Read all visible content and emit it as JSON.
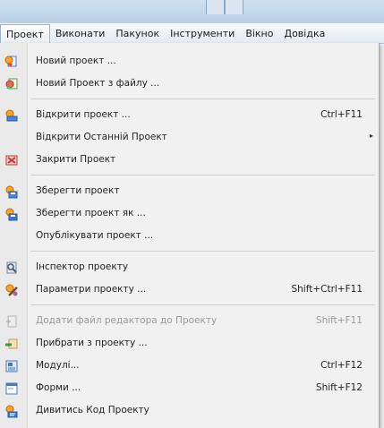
{
  "menubar": {
    "items": [
      {
        "label": "Проект"
      },
      {
        "label": "Виконати"
      },
      {
        "label": "Пакунок"
      },
      {
        "label": "Інструменти"
      },
      {
        "label": "Вікно"
      },
      {
        "label": "Довідка"
      }
    ]
  },
  "menu": {
    "items": [
      {
        "label": "Новий проект ...",
        "shortcut": "",
        "icon": "new-project-icon"
      },
      {
        "label": "Новий Проект з файлу ...",
        "shortcut": "",
        "icon": "new-project-from-file-icon"
      },
      {
        "label": "Відкрити проект ...",
        "shortcut": "Ctrl+F11",
        "icon": "open-project-icon"
      },
      {
        "label": "Відкрити Останній Проект",
        "shortcut": "",
        "arrow": "▸"
      },
      {
        "label": "Закрити Проект",
        "shortcut": "",
        "icon": "close-project-icon"
      },
      {
        "label": "Зберегти проект",
        "shortcut": "",
        "icon": "save-project-icon"
      },
      {
        "label": "Зберегти проект як ...",
        "shortcut": "",
        "icon": "save-project-as-icon"
      },
      {
        "label": "Опублікувати проект ...",
        "shortcut": ""
      },
      {
        "label": "Інспектор проекту",
        "shortcut": "",
        "icon": "project-inspector-icon"
      },
      {
        "label": "Параметри проекту ...",
        "shortcut": "Shift+Ctrl+F11",
        "icon": "project-options-icon"
      },
      {
        "label": "Додати файл редактора до Проекту",
        "shortcut": "Shift+F11",
        "icon": "add-editor-file-icon",
        "disabled": true
      },
      {
        "label": "Прибрати з проекту ...",
        "shortcut": "",
        "icon": "remove-from-project-icon"
      },
      {
        "label": "Модулі...",
        "shortcut": "Ctrl+F12",
        "icon": "units-icon"
      },
      {
        "label": "Форми ...",
        "shortcut": "Shift+F12",
        "icon": "forms-icon"
      },
      {
        "label": "Дивитись Код Проекту",
        "shortcut": "",
        "icon": "view-source-icon"
      }
    ]
  }
}
